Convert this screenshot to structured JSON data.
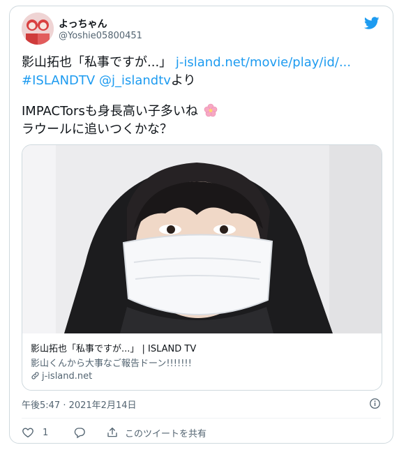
{
  "user": {
    "display_name": "よっちゃん",
    "handle": "@Yoshie05800451"
  },
  "tweet": {
    "text_plain_1": "影山拓也「私事ですが...」 ",
    "link_url": "j-island.net/movie/play/id/...",
    "hashtag": "#ISLANDTV",
    "mention": "@j_islandtv",
    "text_plain_2": "より",
    "line3": "IMPACTorsも身長高い子多いね",
    "line4": "ラウールに追いつくかな？"
  },
  "link_card": {
    "title": "影山拓也「私事ですが...」 | ISLAND TV",
    "description": "影山くんから大事なご報告ドーン!!!!!!!",
    "domain": "j-island.net"
  },
  "meta": {
    "timestamp": "午後5:47 · 2021年2月14日"
  },
  "actions": {
    "like_count": "1",
    "share_label": "このツイートを共有"
  },
  "icons": {
    "brand": "twitter-bird-icon",
    "emoji": "cherry-blossom-icon",
    "info": "info-icon",
    "like": "heart-icon",
    "reply": "reply-icon",
    "share": "share-icon",
    "link": "link-icon"
  },
  "colors": {
    "accent": "#1d9bf0",
    "text": "#0f1419",
    "muted": "#536471",
    "border": "#cfd9de"
  }
}
